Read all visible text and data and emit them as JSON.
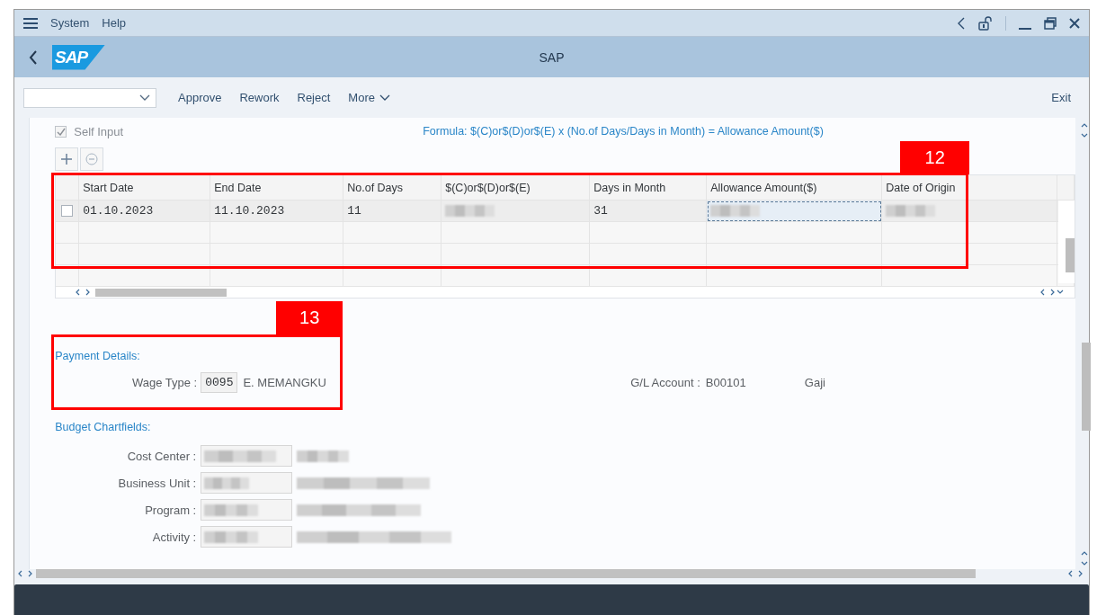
{
  "menu_bar": {
    "items": [
      "System",
      "Help"
    ]
  },
  "header": {
    "title": "SAP",
    "logo": "SAP"
  },
  "toolbar": {
    "buttons": [
      "Approve",
      "Rework",
      "Reject"
    ],
    "more": "More",
    "exit": "Exit"
  },
  "self_input": {
    "label": "Self Input",
    "checked": true
  },
  "formula": "Formula: $(C)or$(D)or$(E) x (No.of Days/Days in Month) = Allowance Amount($)",
  "table": {
    "columns": [
      "Start Date",
      "End Date",
      "No.of Days",
      "$(C)or$(D)or$(E)",
      "Days in Month",
      "Allowance Amount($)",
      "Date of Origin"
    ],
    "rows": [
      {
        "selected": false,
        "cells": [
          {
            "kind": "mono",
            "text": "01.10.2023"
          },
          {
            "kind": "mono",
            "text": "11.10.2023"
          },
          {
            "kind": "mono",
            "text": "11"
          },
          {
            "kind": "redacted"
          },
          {
            "kind": "mono",
            "text": "31"
          },
          {
            "kind": "redacted",
            "focused": true
          },
          {
            "kind": "redacted"
          }
        ]
      }
    ]
  },
  "callouts": [
    {
      "label": "12"
    },
    {
      "label": "13"
    }
  ],
  "payment_details": {
    "title": "Payment Details:",
    "wage_type": {
      "label": "Wage Type :",
      "code": "0095",
      "text": "E. MEMANGKU"
    },
    "gl_account": {
      "label": "G/L Account :",
      "value": "B00101",
      "text": "Gaji"
    }
  },
  "budget": {
    "title": "Budget Chartfields:",
    "fields": [
      {
        "label": "Cost Center :"
      },
      {
        "label": "Business Unit :"
      },
      {
        "label": "Program :"
      },
      {
        "label": "Activity :"
      }
    ]
  }
}
